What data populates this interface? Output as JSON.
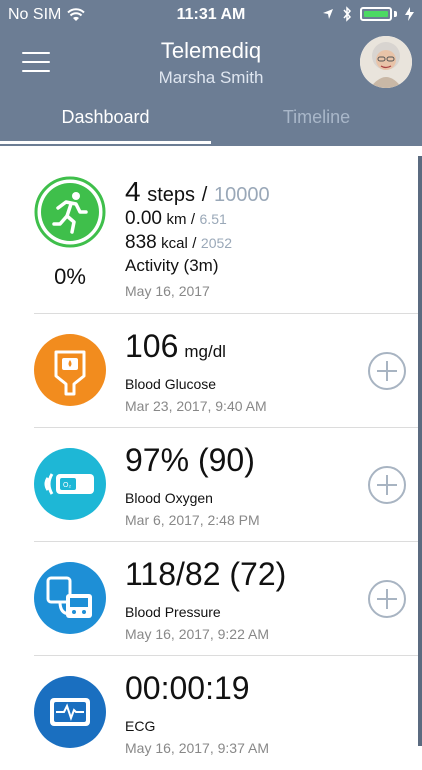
{
  "status_bar": {
    "carrier": "No SIM",
    "time": "11:31 AM"
  },
  "header": {
    "title": "Telemediq",
    "subtitle": "Marsha Smith"
  },
  "tabs": [
    {
      "label": "Dashboard",
      "active": true
    },
    {
      "label": "Timeline",
      "active": false
    }
  ],
  "activity": {
    "percent": "0%",
    "steps": "4",
    "steps_unit": "steps",
    "steps_goal": "10000",
    "km": "0.00",
    "km_unit": "km",
    "km_goal": "6.51",
    "kcal": "838",
    "kcal_unit": "kcal",
    "kcal_goal": "2052",
    "activity_label": "Activity (3m)",
    "date": "May 16, 2017"
  },
  "readings": [
    {
      "value": "106",
      "unit": "mg/dl",
      "label": "Blood Glucose",
      "date": "Mar 23, 2017, 9:40 AM",
      "icon": "glucose-meter-icon",
      "color": "#f28c1e"
    },
    {
      "value": "97% (90)",
      "unit": "",
      "label": "Blood Oxygen",
      "date": "Mar 6, 2017, 2:48 PM",
      "icon": "pulse-oximeter-icon",
      "color": "#1eb7d6"
    },
    {
      "value": "118/82 (72)",
      "unit": "",
      "label": "Blood Pressure",
      "date": "May 16, 2017, 9:22 AM",
      "icon": "blood-pressure-monitor-icon",
      "color": "#1e8fd6"
    },
    {
      "value": "00:00:19",
      "unit": "",
      "label": "ECG",
      "date": "May 16, 2017, 9:37 AM",
      "icon": "ecg-device-icon",
      "color": "#1a6fc0"
    }
  ]
}
